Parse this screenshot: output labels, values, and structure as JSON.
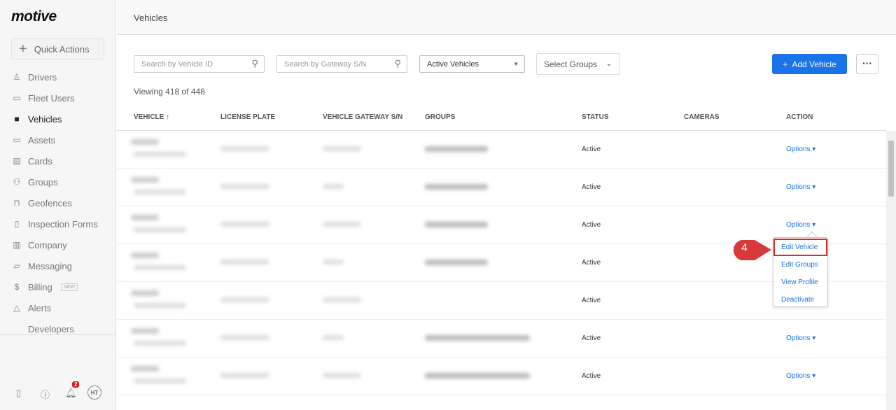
{
  "app": {
    "logo": "motive",
    "quick_actions": "Quick Actions"
  },
  "sidebar": {
    "items": [
      {
        "label": "Drivers",
        "icon": "user-icon"
      },
      {
        "label": "Fleet Users",
        "icon": "monitor-icon"
      },
      {
        "label": "Vehicles",
        "icon": "truck-icon"
      },
      {
        "label": "Assets",
        "icon": "trailer-icon"
      },
      {
        "label": "Cards",
        "icon": "card-icon"
      },
      {
        "label": "Groups",
        "icon": "groups-icon"
      },
      {
        "label": "Geofences",
        "icon": "geofence-icon"
      },
      {
        "label": "Inspection Forms",
        "icon": "document-icon"
      },
      {
        "label": "Company",
        "icon": "building-icon"
      },
      {
        "label": "Messaging",
        "icon": "message-icon"
      },
      {
        "label": "Billing",
        "icon": "billing-icon"
      },
      {
        "label": "Alerts",
        "icon": "bell-icon"
      },
      {
        "label": "Developers",
        "icon": "code-icon"
      }
    ],
    "billing_badge": "NEW",
    "notifications": "2",
    "avatar": "HT"
  },
  "header": {
    "title": "Vehicles"
  },
  "toolbar": {
    "search_vehicle_placeholder": "Search by Vehicle ID",
    "search_gateway_placeholder": "Search by Gateway S/N",
    "filter": "Active Vehicles",
    "groups": "Select Groups",
    "add": "Add Vehicle",
    "more": "···"
  },
  "viewing": "Viewing 418 of 448",
  "columns": [
    "VEHICLE ↑",
    "LICENSE PLATE",
    "VEHICLE GATEWAY S/N",
    "GROUPS",
    "STATUS",
    "CAMERAS",
    "ACTION"
  ],
  "rows": [
    {
      "status": "Active",
      "action": "Options ▾"
    },
    {
      "status": "Active",
      "action": "Options ▾"
    },
    {
      "status": "Active",
      "action": "Options ▾"
    },
    {
      "status": "Active",
      "action": ""
    },
    {
      "status": "Active",
      "action": ""
    },
    {
      "status": "Active",
      "action": "Options ▾"
    },
    {
      "status": "Active",
      "action": "Options ▾"
    }
  ],
  "menu": [
    "Edit Vehicle",
    "Edit Groups",
    "View Profile",
    "Deactivate"
  ],
  "step": "4"
}
